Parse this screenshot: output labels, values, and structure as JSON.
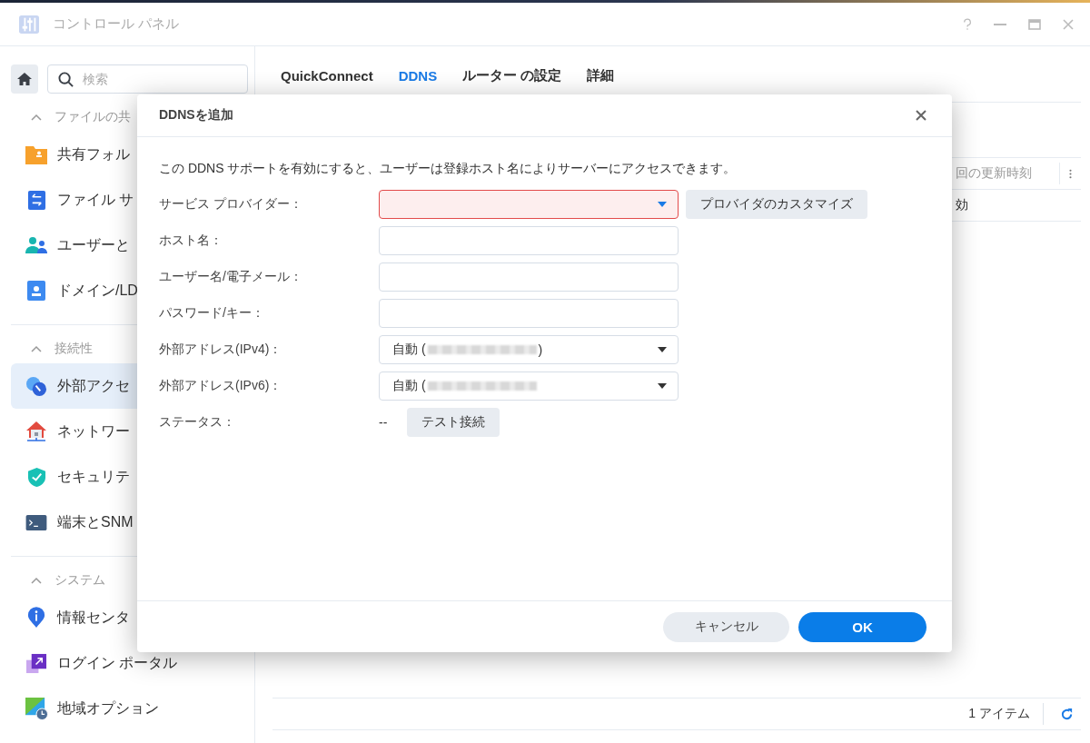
{
  "window": {
    "title": "コントロール パネル"
  },
  "sidebar": {
    "search": {
      "placeholder": "検索"
    },
    "sections": [
      {
        "title": "ファイルの共",
        "expanded": true,
        "items": [
          {
            "label": "共有フォル",
            "selected": false
          },
          {
            "label": "ファイル サ",
            "selected": false
          },
          {
            "label": "ユーザーと",
            "selected": false
          },
          {
            "label": "ドメイン/LD",
            "selected": false
          }
        ]
      },
      {
        "title": "接続性",
        "expanded": true,
        "items": [
          {
            "label": "外部アクセ",
            "selected": true
          },
          {
            "label": "ネットワー",
            "selected": false
          },
          {
            "label": "セキュリテ",
            "selected": false
          },
          {
            "label": "端末とSNM",
            "selected": false
          }
        ]
      },
      {
        "title": "システム",
        "expanded": true,
        "items": [
          {
            "label": "情報センタ",
            "selected": false
          },
          {
            "label": "ログイン ポータル",
            "selected": false
          },
          {
            "label": "地域オプション",
            "selected": false
          }
        ]
      }
    ]
  },
  "tabs": [
    {
      "label": "QuickConnect",
      "selected": false
    },
    {
      "label": "DDNS",
      "selected": true
    },
    {
      "label": "ルーター の設定",
      "selected": false
    },
    {
      "label": "詳細",
      "selected": false
    }
  ],
  "table": {
    "columns": [
      "回の更新時刻"
    ],
    "rows": [
      [
        "効"
      ]
    ]
  },
  "status_bar": {
    "count": "1 アイテム"
  },
  "dialog": {
    "title": "DDNSを追加",
    "description": "この DDNS サポートを有効にすると、ユーザーは登録ホスト名によりサーバーにアクセスできます。",
    "fields": [
      {
        "kind": "select",
        "label": "サービス プロバイダー：",
        "invalid": true,
        "button": "プロバイダのカスタマイズ"
      },
      {
        "kind": "text",
        "label": "ホスト名：",
        "invalid": false
      },
      {
        "kind": "text",
        "label": "ユーザー名/電子メール：",
        "invalid": false
      },
      {
        "kind": "text",
        "label": "パスワード/キー：",
        "invalid": false
      },
      {
        "kind": "select",
        "label": "外部アドレス(IPv4)：",
        "invalid": false,
        "value": "自動 (",
        "redacted": true,
        "value_end": ")"
      },
      {
        "kind": "select",
        "label": "外部アドレス(IPv6)：",
        "invalid": false,
        "value": "自動 (",
        "redacted": true
      },
      {
        "kind": "status",
        "label": "ステータス：",
        "value": "--",
        "button": "テスト接続"
      }
    ],
    "buttons": [
      {
        "label": "キャンセル",
        "kind": "secondary"
      },
      {
        "label": "OK",
        "kind": "primary"
      }
    ]
  }
}
